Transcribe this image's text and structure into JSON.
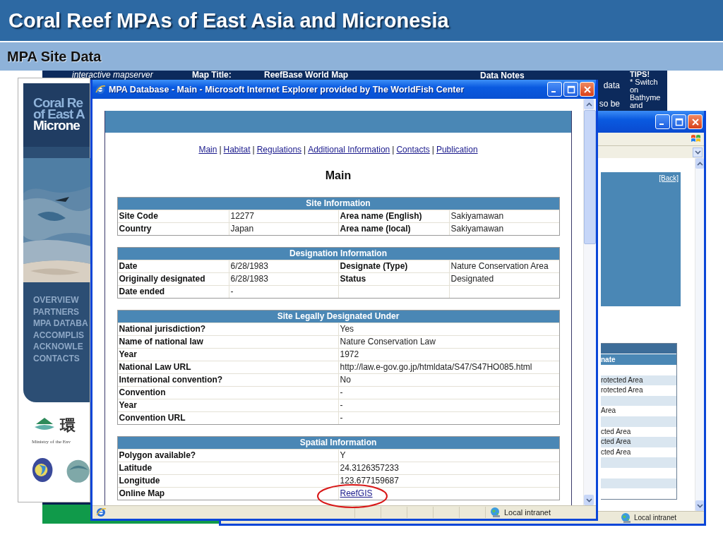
{
  "slide": {
    "title": "Coral Reef MPAs of East Asia and Micronesia",
    "subtitle": "MPA Site Data"
  },
  "map_window": {
    "caption": "interactive mapserver",
    "map_title_label": "Map Title:",
    "map_title": "ReefBase World Map",
    "notes_label": "Data Notes",
    "notes_lines": [
      "data",
      "so be"
    ],
    "tips_label": "TIPS!",
    "tips_lines": [
      "* Switch",
      "on",
      "Bathyme",
      "and"
    ]
  },
  "site_window": {
    "logo_lines": [
      "Coral Re",
      "of East A",
      "Microne"
    ],
    "nav_items": [
      "OVERVIEW",
      "PARTNERS",
      "MPA DATABA",
      "ACCOMPLIS",
      "ACKNOWLE",
      "CONTACTS"
    ],
    "partner_mark": "環",
    "partner_caption": "Ministry of the Env"
  },
  "detail_window": {
    "back_link": "[Back]",
    "column_header": "nate",
    "rows": [
      {},
      {
        "text": "rotected Area"
      },
      {
        "text": "rotected Area"
      },
      {},
      {
        "text": "Area"
      },
      {},
      {
        "text": "cted Area"
      },
      {
        "text": "cted Area"
      },
      {
        "text": "cted Area"
      },
      {},
      {},
      {},
      {}
    ],
    "status": "Local intranet"
  },
  "main_window": {
    "title": "MPA Database - Main - Microsoft Internet Explorer provided by The WorldFish Center",
    "nav": [
      {
        "kind": "link",
        "text": "Main"
      },
      {
        "kind": "separator",
        "text": "|"
      },
      {
        "kind": "link",
        "text": "Habitat"
      },
      {
        "kind": "separator",
        "text": "|"
      },
      {
        "kind": "link",
        "text": "Regulations"
      },
      {
        "kind": "separator",
        "text": "|"
      },
      {
        "kind": "link",
        "text": "Additional Information"
      },
      {
        "kind": "separator",
        "text": "|"
      },
      {
        "kind": "link",
        "text": "Contacts"
      },
      {
        "kind": "separator",
        "text": "|"
      },
      {
        "kind": "link",
        "text": "Publication"
      }
    ],
    "heading": "Main",
    "sections": [
      {
        "title": "Site Information",
        "kind": "four_column",
        "rows": [
          [
            "Site Code",
            "12277",
            "Area name (English)",
            "Sakiyamawan"
          ],
          [
            "Country",
            "Japan",
            "Area name (local)",
            "Sakiyamawan"
          ]
        ]
      },
      {
        "title": "Designation Information",
        "kind": "four_column",
        "rows": [
          [
            "Date",
            "6/28/1983",
            "Designate (Type)",
            "Nature Conservation Area"
          ],
          [
            "Originally designated",
            "6/28/1983",
            "Status",
            "Designated"
          ],
          [
            "Date ended",
            "-"
          ]
        ]
      },
      {
        "title": "Site Legally Designated Under",
        "kind": "two_column",
        "rows": [
          [
            "National jurisdiction?",
            "Yes"
          ],
          [
            "Name of national law",
            "Nature Conservation Law"
          ],
          [
            "Year",
            "1972"
          ],
          [
            "National Law URL",
            "http://law.e-gov.go.jp/htmldata/S47/S47HO085.html"
          ],
          [
            "International convention?",
            "No"
          ],
          [
            "Convention",
            "-"
          ],
          [
            "Year",
            "-"
          ],
          [
            "Convention URL",
            "-"
          ]
        ]
      },
      {
        "title": "Spatial Information",
        "kind": "two_column",
        "rows": [
          [
            "Polygon available?",
            "Y"
          ],
          [
            "Latitude",
            "24.3126357233"
          ],
          [
            "Longitude",
            "123.677159687"
          ],
          [
            "Online Map",
            {
              "kind": "link",
              "text": "ReefGIS"
            }
          ]
        ]
      }
    ],
    "status": "Local intranet"
  }
}
